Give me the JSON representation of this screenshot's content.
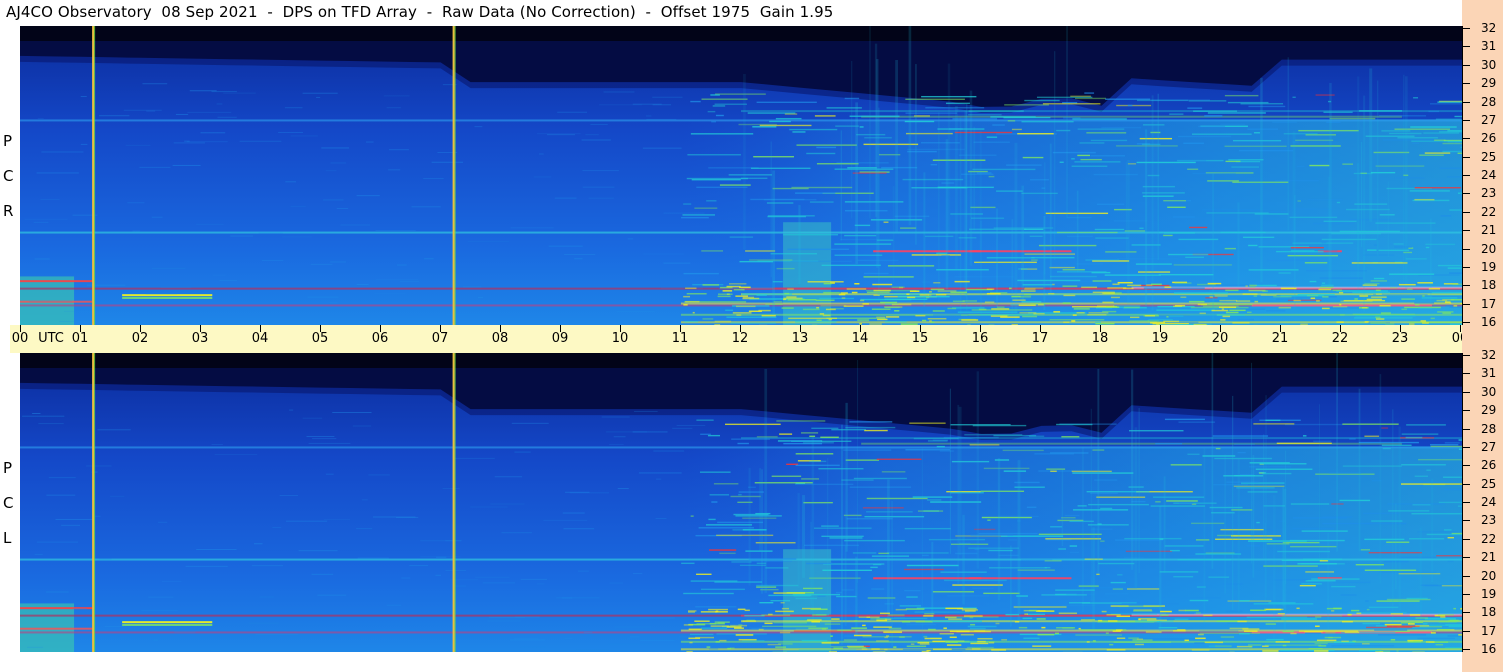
{
  "title": "AJ4CO Observatory  08 Sep 2021  -  DPS on TFD Array  -  Raw Data (No Correction)  -  Offset 1975  Gain 1.95",
  "chart_data": {
    "type": "heatmap",
    "title": "AJ4CO Observatory  08 Sep 2021  -  DPS on TFD Array  -  Raw Data (No Correction)  -  Offset 1975  Gain 1.95",
    "x_axis": {
      "label_utc": "UTC",
      "unit": "MHz",
      "tick_labels": [
        "00",
        "01",
        "02",
        "03",
        "04",
        "05",
        "06",
        "07",
        "08",
        "09",
        "10",
        "11",
        "12",
        "13",
        "14",
        "15",
        "16",
        "17",
        "18",
        "19",
        "20",
        "21",
        "22",
        "23",
        "00"
      ],
      "range": [
        0,
        24
      ]
    },
    "y_axis": {
      "unit": "MHz",
      "range": [
        16,
        32
      ],
      "tick_labels": [
        "32",
        "31",
        "30",
        "29",
        "28",
        "27",
        "26",
        "25",
        "24",
        "23",
        "22",
        "21",
        "20",
        "19",
        "18",
        "17",
        "16"
      ]
    },
    "panels": [
      {
        "name": "RCP",
        "letters": [
          "P",
          "C",
          "R"
        ]
      },
      {
        "name": "LCP",
        "letters": [
          "P",
          "C",
          "L"
        ]
      }
    ],
    "colormap": [
      "#000020",
      "#0a1f8c",
      "#1a55d8",
      "#1f8fe8",
      "#22d0d8",
      "#7fe860",
      "#f0f020",
      "#ff3030",
      "#f0d0f0"
    ],
    "vertical_markers_utc": [
      1.2,
      7.2
    ],
    "activity": "Dense emission bands from ~11 UTC to 24 UTC at 16-28 MHz; quiet noise floor elsewhere; top band dark near 30-32 MHz"
  },
  "pol_labels": {
    "rcp": [
      "P",
      "C",
      "R"
    ],
    "lcp": [
      "P",
      "C",
      "L"
    ]
  }
}
